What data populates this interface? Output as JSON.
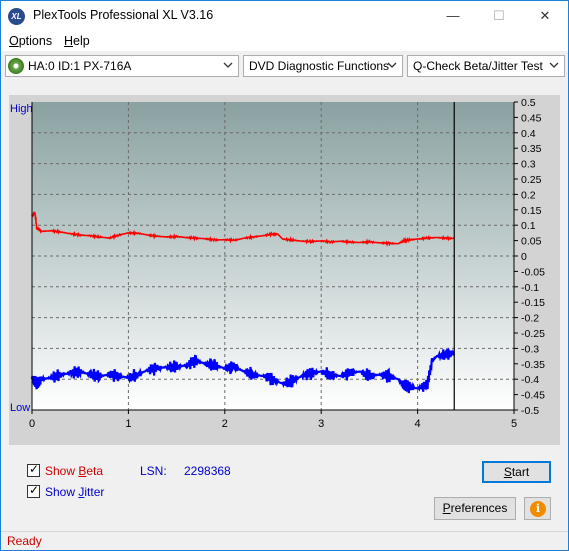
{
  "window": {
    "title": "PlexTools Professional XL V3.16",
    "icon_text": "XL",
    "min_symbol": "—",
    "max_symbol": "☐",
    "close_symbol": "✕"
  },
  "menu": {
    "items": [
      {
        "label_rest": "ptions",
        "mnemonic": "O"
      },
      {
        "label_rest": "elp",
        "mnemonic": "H"
      }
    ]
  },
  "toolbar": {
    "drive": "HA:0 ID:1  PX-716A",
    "function": "DVD Diagnostic Functions",
    "test": "Q-Check Beta/Jitter Test"
  },
  "chart_data": {
    "type": "line",
    "x_ticks": [
      "0",
      "1",
      "2",
      "3",
      "4",
      "5"
    ],
    "xlim": [
      0,
      5
    ],
    "left_labels": {
      "top": "High",
      "bottom": "Low"
    },
    "right_ticks": [
      "0.5",
      "0.45",
      "0.4",
      "0.35",
      "0.3",
      "0.25",
      "0.2",
      "0.15",
      "0.1",
      "0.05",
      "0",
      "-0.05",
      "-0.1",
      "-0.15",
      "-0.2",
      "-0.25",
      "-0.3",
      "-0.35",
      "-0.4",
      "-0.45",
      "-0.5"
    ],
    "ylim": [
      -0.5,
      0.5
    ],
    "grid": true,
    "cursor_x": 4.38,
    "series": [
      {
        "name": "Beta",
        "color": "#ff0000",
        "x": [
          0.0,
          0.03,
          0.05,
          0.1,
          0.2,
          0.3,
          0.4,
          0.5,
          0.6,
          0.7,
          0.8,
          0.9,
          1.0,
          1.1,
          1.2,
          1.3,
          1.4,
          1.5,
          1.6,
          1.7,
          1.8,
          1.9,
          2.0,
          2.1,
          2.2,
          2.3,
          2.4,
          2.5,
          2.55,
          2.6,
          2.7,
          2.8,
          2.9,
          3.0,
          3.1,
          3.2,
          3.3,
          3.4,
          3.5,
          3.6,
          3.7,
          3.8,
          3.85,
          3.9,
          4.0,
          4.1,
          4.2,
          4.3,
          4.38
        ],
        "values": [
          0.13,
          0.14,
          0.09,
          0.08,
          0.082,
          0.078,
          0.072,
          0.068,
          0.066,
          0.062,
          0.058,
          0.068,
          0.075,
          0.074,
          0.068,
          0.064,
          0.062,
          0.063,
          0.06,
          0.058,
          0.056,
          0.052,
          0.053,
          0.051,
          0.058,
          0.062,
          0.066,
          0.072,
          0.071,
          0.055,
          0.052,
          0.048,
          0.047,
          0.049,
          0.046,
          0.048,
          0.045,
          0.044,
          0.046,
          0.043,
          0.041,
          0.04,
          0.048,
          0.052,
          0.055,
          0.058,
          0.06,
          0.058,
          0.057
        ]
      },
      {
        "name": "Jitter",
        "color": "#0000ff",
        "x": [
          0.0,
          0.05,
          0.1,
          0.2,
          0.3,
          0.4,
          0.5,
          0.6,
          0.7,
          0.8,
          0.9,
          1.0,
          1.1,
          1.2,
          1.3,
          1.4,
          1.5,
          1.6,
          1.7,
          1.8,
          1.9,
          2.0,
          2.1,
          2.2,
          2.3,
          2.4,
          2.5,
          2.6,
          2.7,
          2.8,
          2.9,
          3.0,
          3.1,
          3.2,
          3.3,
          3.4,
          3.5,
          3.6,
          3.7,
          3.8,
          3.85,
          3.9,
          4.0,
          4.1,
          4.15,
          4.2,
          4.3,
          4.38
        ],
        "values": [
          -0.4,
          -0.41,
          -0.4,
          -0.395,
          -0.385,
          -0.38,
          -0.375,
          -0.385,
          -0.39,
          -0.385,
          -0.39,
          -0.395,
          -0.385,
          -0.37,
          -0.365,
          -0.36,
          -0.36,
          -0.355,
          -0.34,
          -0.35,
          -0.355,
          -0.365,
          -0.36,
          -0.375,
          -0.385,
          -0.39,
          -0.4,
          -0.415,
          -0.405,
          -0.39,
          -0.38,
          -0.375,
          -0.385,
          -0.39,
          -0.38,
          -0.375,
          -0.39,
          -0.385,
          -0.39,
          -0.4,
          -0.42,
          -0.425,
          -0.43,
          -0.42,
          -0.34,
          -0.325,
          -0.32,
          -0.315
        ]
      }
    ]
  },
  "controls": {
    "show_beta_prefix": "Show ",
    "show_beta_mnemonic": "B",
    "show_beta_rest": "eta",
    "show_jitter_prefix": "Show ",
    "show_jitter_mnemonic": "J",
    "show_jitter_rest": "itter",
    "lsn_label": "LSN:",
    "lsn_value": "2298368",
    "start_mnemonic": "S",
    "start_rest": "tart",
    "preferences_prefix": "",
    "preferences_mnemonic": "P",
    "preferences_rest": "references",
    "info_symbol": "i"
  },
  "status": {
    "text": "Ready"
  },
  "colors": {
    "accent_blue": "#0000cc",
    "beta_label": "#cc0000",
    "status_red": "#cc0000"
  }
}
